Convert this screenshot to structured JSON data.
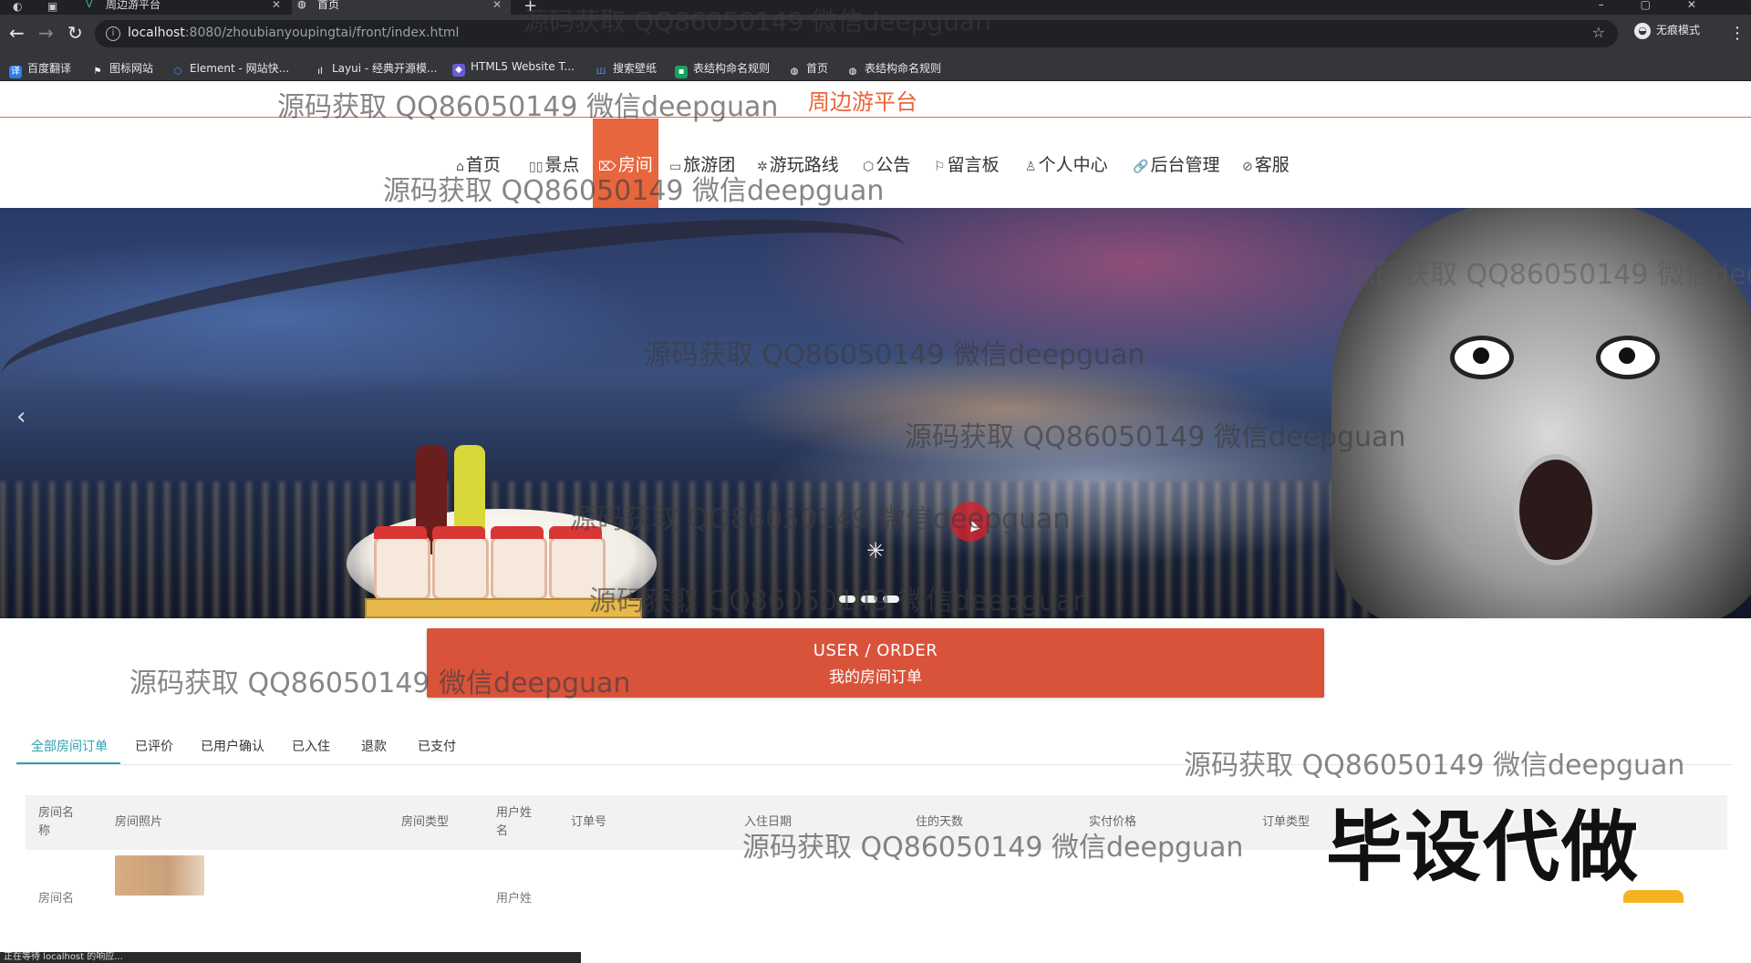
{
  "browser": {
    "tabs": [
      {
        "label": "周边游平台",
        "favicon": "vue-icon"
      },
      {
        "label": "首页",
        "favicon": "globe-icon"
      }
    ],
    "url_host": "localhost",
    "url_rest": ":8080/zhoubianyoupingtai/front/index.html",
    "incognito_label": "无痕模式",
    "bookmarks": [
      {
        "label": "百度翻译",
        "color": "#2b7de9"
      },
      {
        "label": "图标网站",
        "color": "#ffffff"
      },
      {
        "label": "Element - 网站快...",
        "color": "#409eff"
      },
      {
        "label": "Layui - 经典开源模...",
        "color": "#ffffff"
      },
      {
        "label": "HTML5 Website T...",
        "color": "#6b5bd6"
      },
      {
        "label": "搜索壁纸",
        "color": "#1e6fd9"
      },
      {
        "label": "表结构命名规则",
        "color": "#19a15f"
      },
      {
        "label": "首页",
        "color": "#ffffff"
      },
      {
        "label": "表结构命名规则",
        "color": "#ffffff"
      }
    ]
  },
  "site": {
    "title": "周边游平台",
    "nav": [
      {
        "label": "首页",
        "icon": "⌂"
      },
      {
        "label": "景点",
        "icon": "▯▯"
      },
      {
        "label": "房间",
        "icon": "⌦"
      },
      {
        "label": "旅游团",
        "icon": "▭"
      },
      {
        "label": "游玩路线",
        "icon": "✲"
      },
      {
        "label": "公告",
        "icon": "⬡"
      },
      {
        "label": "留言板",
        "icon": "⚐"
      },
      {
        "label": "个人中心",
        "icon": "♙"
      },
      {
        "label": "后台管理",
        "icon": "🔗"
      },
      {
        "label": "客服",
        "icon": "⊘"
      }
    ],
    "active_nav": "房间"
  },
  "order_banner": {
    "en": "USER / ORDER",
    "cn": "我的房间订单"
  },
  "subtabs": [
    "全部房间订单",
    "已评价",
    "已用户确认",
    "已入住",
    "退款",
    "已支付"
  ],
  "table": {
    "headers": [
      "房间名称",
      "房间照片",
      "房间类型",
      "用户姓名",
      "订单号",
      "入住日期",
      "住的天数",
      "实付价格",
      "订单类型"
    ],
    "row_partial": {
      "name": "房间名",
      "user": "用户姓"
    }
  },
  "overlay_tag": "毕设代做",
  "watermark": "源码获取 QQ86050149 微信deepguan",
  "status_bar": "正在等待 localhost 的响应..."
}
